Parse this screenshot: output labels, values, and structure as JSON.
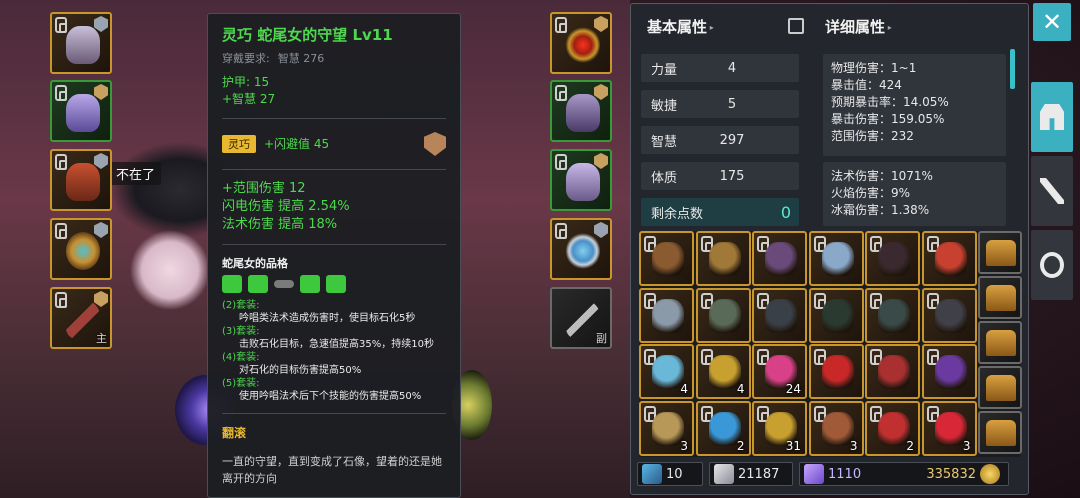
{
  "scene": {
    "npc_label": "不在了"
  },
  "equip_left": [
    {
      "name": "helmet",
      "sub": ""
    },
    {
      "name": "armor",
      "sub": ""
    },
    {
      "name": "pants",
      "sub": ""
    },
    {
      "name": "ring",
      "sub": ""
    },
    {
      "name": "staff",
      "sub": "主"
    }
  ],
  "equip_right": [
    {
      "name": "necklace",
      "sub": ""
    },
    {
      "name": "gloves",
      "sub": ""
    },
    {
      "name": "boots",
      "sub": ""
    },
    {
      "name": "ring2",
      "sub": ""
    },
    {
      "name": "sword",
      "sub": "副"
    }
  ],
  "tooltip": {
    "title": "灵巧 蛇尾女的守望 Lv11",
    "req_label": "穿戴要求:",
    "req_value": "智慧 276",
    "armor": "护甲: 15",
    "stat_bonus": "+智慧 27",
    "enchant_tag": "灵巧",
    "enchant_value": "+闪避值 45",
    "bonus_1": "+范围伤害 12",
    "bonus_2": "闪电伤害 提高 2.54%",
    "bonus_3": "法术伤害 提高 18%",
    "set_title": "蛇尾女的品格",
    "set_lines": [
      {
        "label": "(2)套装:",
        "desc": "吟唱类法术造成伤害时，使目标石化5秒"
      },
      {
        "label": "(3)套装:",
        "desc": "击败石化目标，急速值提高35%，持续10秒"
      },
      {
        "label": "(4)套装:",
        "desc": "对石化的目标伤害提高50%"
      },
      {
        "label": "(5)套装:",
        "desc": "使用吟唱法术后下个技能的伤害提高50%"
      }
    ],
    "flavor_title": "翻滚",
    "flavor_text": "一直的守望，直到变成了石像，望着的还是她离开的方向"
  },
  "basic_attr": {
    "title": "基本属性",
    "rows": [
      {
        "k": "力量",
        "v": "4"
      },
      {
        "k": "敏捷",
        "v": "5"
      },
      {
        "k": "智慧",
        "v": "297"
      },
      {
        "k": "体质",
        "v": "175"
      }
    ],
    "free_label": "剩余点数",
    "free_value": "0"
  },
  "detail_attr": {
    "title": "详细属性",
    "group1": [
      "物理伤害：1~1",
      "暴击值：424",
      "预期暴击率：14.05%",
      "暴击伤害：159.05%",
      "范围伤害：232"
    ],
    "group2": [
      "法术伤害：1071%",
      "火焰伤害：9%",
      "冰霜伤害：1.38%"
    ]
  },
  "inventory": [
    {
      "color": "#8a5a30",
      "count": ""
    },
    {
      "color": "#a07838",
      "count": ""
    },
    {
      "color": "#6a4a7a",
      "count": ""
    },
    {
      "color": "#8aa8c8",
      "count": ""
    },
    {
      "color": "#3a2a30",
      "count": ""
    },
    {
      "color": "#c84030",
      "count": ""
    },
    {
      "color": "#8a9aa8",
      "count": ""
    },
    {
      "color": "#5a6a58",
      "count": ""
    },
    {
      "color": "#3a4048",
      "count": ""
    },
    {
      "color": "#2a3a30",
      "count": ""
    },
    {
      "color": "#3a4a48",
      "count": ""
    },
    {
      "color": "#404048",
      "count": ""
    },
    {
      "color": "#6ab8d8",
      "count": "4"
    },
    {
      "color": "#c8a030",
      "count": "4"
    },
    {
      "color": "#d84088",
      "count": "24"
    },
    {
      "color": "#c82828",
      "count": ""
    },
    {
      "color": "#a83030",
      "count": ""
    },
    {
      "color": "#6a3aa0",
      "count": ""
    },
    {
      "color": "#b89858",
      "count": "3"
    },
    {
      "color": "#3a98d8",
      "count": "2"
    },
    {
      "color": "#c8a030",
      "count": "31"
    },
    {
      "color": "#a05a38",
      "count": "3"
    },
    {
      "color": "#c03030",
      "count": "2"
    },
    {
      "color": "#d82838",
      "count": "3"
    }
  ],
  "chests": [
    "chest",
    "chest",
    "chest",
    "chest",
    "chest"
  ],
  "bottom_bar": {
    "weapon_value": "10",
    "shield_value": "21187",
    "mana_value": "1110",
    "gold_value": "335832"
  },
  "ui": {
    "close": "✕"
  }
}
